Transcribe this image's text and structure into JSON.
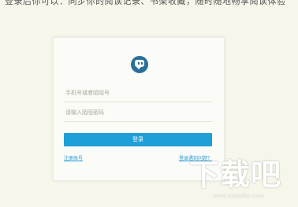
{
  "top_banner": {
    "text": "登录后你可以：同步你的阅读记录、书架收藏，随时随地畅享阅读体验"
  },
  "login": {
    "logo_icon": "chat-bubble-logo-icon",
    "account_placeholder": "手机号或者陌陌号",
    "password_placeholder": "请输入陌陌密码",
    "submit_label": "登录",
    "register_link": "注册账号",
    "forgot_link": "登录遇到问题？"
  },
  "watermark": {
    "text": "下载吧",
    "domain": "www.xiazaiba.com"
  },
  "colors": {
    "background": "#f7f6ea",
    "card": "#fbfbf7",
    "accent": "#1f9fd8",
    "logo": "#2a6f9a"
  }
}
